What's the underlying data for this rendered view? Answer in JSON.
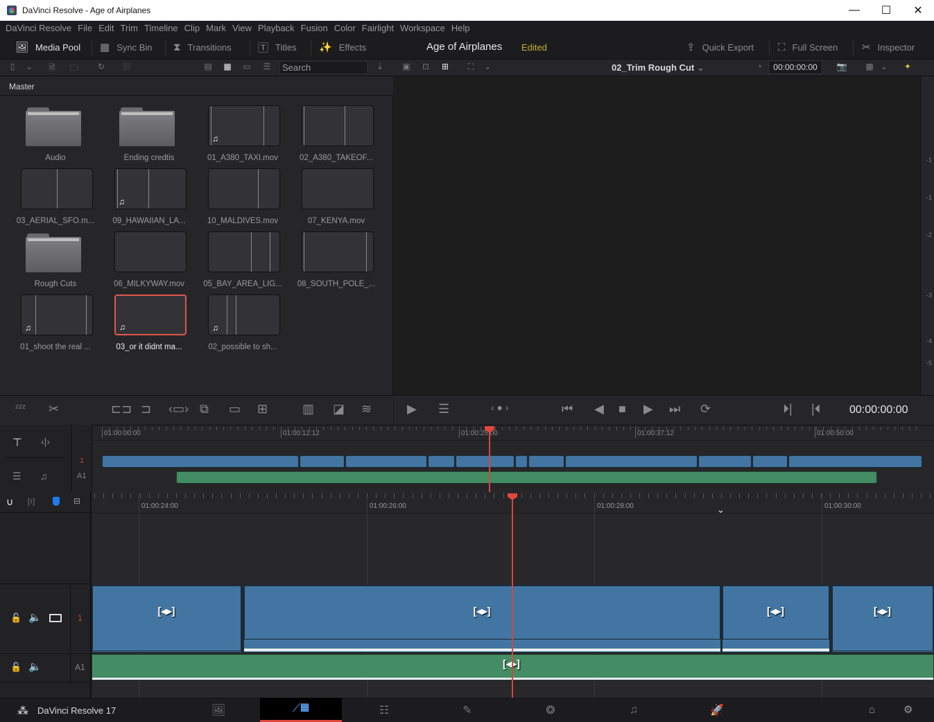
{
  "window": {
    "title": "DaVinci Resolve - Age of Airplanes",
    "minimize": "—",
    "maximize": "☐",
    "close": "✕"
  },
  "menu": [
    "DaVinci Resolve",
    "File",
    "Edit",
    "Trim",
    "Timeline",
    "Clip",
    "Mark",
    "View",
    "Playback",
    "Fusion",
    "Color",
    "Fairlight",
    "Workspace",
    "Help"
  ],
  "toolbar": {
    "media_pool": "Media Pool",
    "sync_bin": "Sync Bin",
    "transitions": "Transitions",
    "titles": "Titles",
    "effects": "Effects",
    "project": "Age of Airplanes",
    "status": "Edited",
    "quick_export": "Quick Export",
    "full_screen": "Full Screen",
    "inspector": "Inspector"
  },
  "pool": {
    "search_placeholder": "Search",
    "bin": "Master",
    "items": [
      {
        "name": "Audio",
        "type": "folder"
      },
      {
        "name": "Ending credtis",
        "type": "folder"
      },
      {
        "name": "01_A380_TAXI.mov",
        "type": "clip",
        "audio": true
      },
      {
        "name": "02_A380_TAKEOF...",
        "type": "clip",
        "audio": false
      },
      {
        "name": "03_AERIAL_SFO.m...",
        "type": "clip",
        "audio": false
      },
      {
        "name": "09_HAWAIIAN_LA...",
        "type": "clip",
        "audio": true
      },
      {
        "name": "10_MALDIVES.mov",
        "type": "clip",
        "audio": false
      },
      {
        "name": "07_KENYA.mov",
        "type": "clip",
        "audio": false
      },
      {
        "name": "Rough Cuts",
        "type": "folder"
      },
      {
        "name": "06_MILKYWAY.mov",
        "type": "clip",
        "audio": false
      },
      {
        "name": "05_BAY_AREA_LIG...",
        "type": "clip",
        "audio": false
      },
      {
        "name": "08_SOUTH_POLE_...",
        "type": "clip",
        "audio": false
      },
      {
        "name": "01_shoot the real ...",
        "type": "clip",
        "audio": true
      },
      {
        "name": "03_or it didnt ma...",
        "type": "clip",
        "audio": true,
        "selected": true
      },
      {
        "name": "02_possible to sh...",
        "type": "clip",
        "audio": true
      }
    ]
  },
  "viewer": {
    "timeline_name": "02_Trim Rough Cut",
    "timecode_in": "00:00:00:00",
    "timecode": "00:00:00:00",
    "meter_ticks": [
      "-",
      "-1",
      "-1",
      "-2",
      "-3",
      "-4",
      "-5"
    ]
  },
  "mini_timeline": {
    "ruler": [
      "01:00:00:00",
      "01:00:12:12",
      "01:00:25:00",
      "01:00:37:12",
      "01:00:50:00"
    ],
    "tracks": {
      "video": "1",
      "audio": "A1"
    }
  },
  "main_timeline": {
    "ruler": [
      "01:00:24:00",
      "01:00:26:00",
      "01:00:28:00",
      "01:00:30:00"
    ],
    "tracks": {
      "video": "1",
      "audio": "A1"
    },
    "trim_icon": "[◂▸]"
  },
  "bottom": {
    "app": "DaVinci Resolve 17",
    "pages": [
      "media",
      "cut",
      "edit",
      "fusion",
      "color",
      "fairlight",
      "deliver"
    ],
    "active_page": "cut"
  },
  "colors": {
    "video_clip": "#4275a1",
    "audio_clip": "#448c63",
    "playhead": "#e0473d",
    "edited": "#c8b02a"
  }
}
